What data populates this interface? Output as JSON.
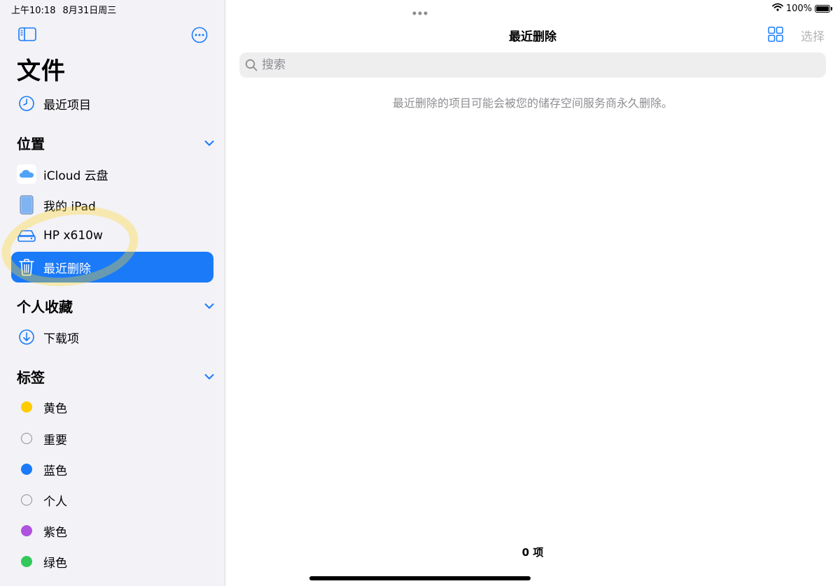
{
  "status": {
    "time": "上午10:18",
    "date": "8月31日周三",
    "battery": "100%"
  },
  "sidebar": {
    "title": "文件",
    "recents": {
      "label": "最近项目",
      "icon": "clock-icon"
    },
    "locations": {
      "title": "位置",
      "items": [
        {
          "label": "iCloud 云盘",
          "icon": "icloud-icon"
        },
        {
          "label": "我的 iPad",
          "icon": "ipad-icon"
        },
        {
          "label": "HP x610w",
          "icon": "drive-icon"
        },
        {
          "label": "最近删除",
          "icon": "trash-icon",
          "selected": true
        }
      ]
    },
    "favorites": {
      "title": "个人收藏",
      "items": [
        {
          "label": "下载项",
          "icon": "download-icon"
        }
      ]
    },
    "tags": {
      "title": "标签",
      "items": [
        {
          "label": "黄色",
          "color": "#ffcc00"
        },
        {
          "label": "重要",
          "color": "none"
        },
        {
          "label": "蓝色",
          "color": "#1a7af8"
        },
        {
          "label": "个人",
          "color": "none"
        },
        {
          "label": "紫色",
          "color": "#af52de"
        },
        {
          "label": "绿色",
          "color": "#34c759"
        }
      ]
    }
  },
  "main": {
    "title": "最近删除",
    "select_label": "选择",
    "search_placeholder": "搜索",
    "info_text": "最近删除的项目可能会被您的储存空间服务商永久删除。",
    "item_count": "0 项"
  },
  "colors": {
    "accent": "#1a7af8",
    "sidebar_bg": "#f2f2f7"
  }
}
